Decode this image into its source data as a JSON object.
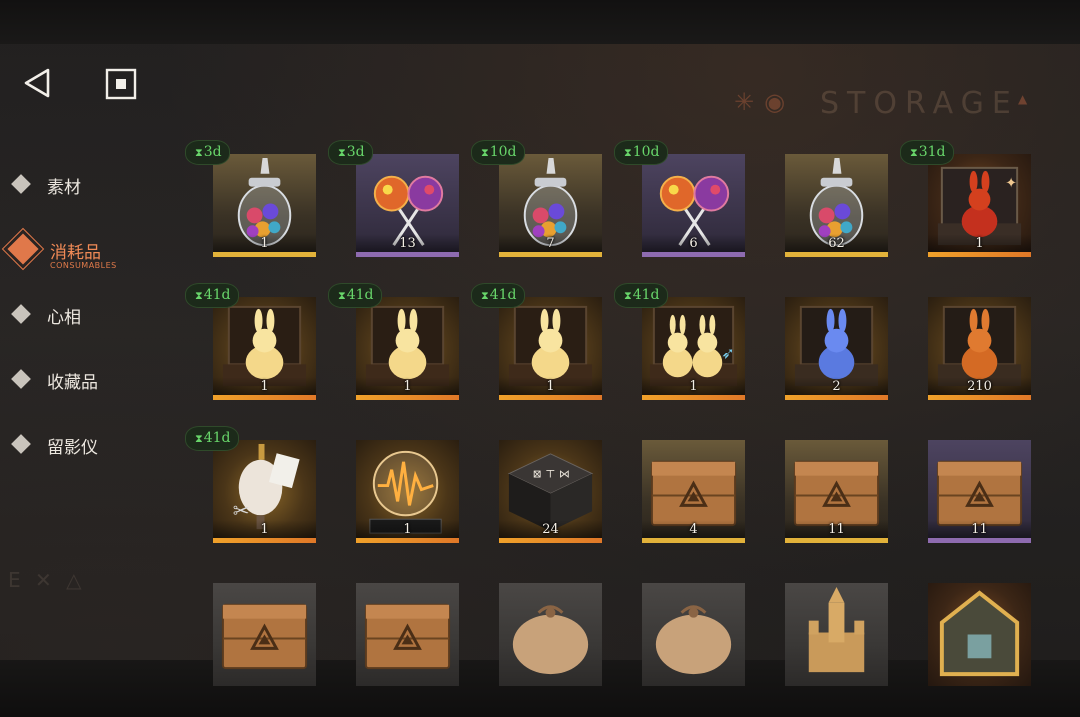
{
  "header": {
    "title": "STORAGE"
  },
  "colors": {
    "accent": "#e0784a",
    "timer": "#68d56a",
    "rarity_gold": "#e2b23a",
    "rarity_purple": "#8e6bb0"
  },
  "nav": {
    "back_icon": "back-triangle-icon",
    "home_icon": "square-home-icon",
    "items": [
      {
        "label": "素材",
        "sub": "",
        "active": false
      },
      {
        "label": "消耗品",
        "sub": "CONSUMABLES",
        "active": true
      },
      {
        "label": "心相",
        "sub": "",
        "active": false
      },
      {
        "label": "收藏品",
        "sub": "",
        "active": false
      },
      {
        "label": "留影仪",
        "sub": "",
        "active": false
      }
    ]
  },
  "items": [
    {
      "timer": "3d",
      "qty": "1",
      "rarity": "gold",
      "art": "candy-jar"
    },
    {
      "timer": "3d",
      "qty": "13",
      "rarity": "purple",
      "art": "lollipops"
    },
    {
      "timer": "10d",
      "qty": "7",
      "rarity": "gold",
      "art": "candy-jar"
    },
    {
      "timer": "10d",
      "qty": "6",
      "rarity": "purple",
      "art": "lollipops"
    },
    {
      "timer": "",
      "qty": "62",
      "rarity": "gold",
      "art": "candy-jar"
    },
    {
      "timer": "31d",
      "qty": "1",
      "rarity": "orange",
      "art": "rabbit-box-red"
    },
    {
      "timer": "41d",
      "qty": "1",
      "rarity": "yellow",
      "art": "rabbit-box-gold"
    },
    {
      "timer": "41d",
      "qty": "1",
      "rarity": "yellow",
      "art": "rabbit-box-gold"
    },
    {
      "timer": "41d",
      "qty": "1",
      "rarity": "yellow",
      "art": "rabbit-box-gold"
    },
    {
      "timer": "41d",
      "qty": "1",
      "rarity": "yellow",
      "art": "rabbit-box-gold-double"
    },
    {
      "timer": "",
      "qty": "2",
      "rarity": "yellow",
      "art": "rabbit-box-blue"
    },
    {
      "timer": "",
      "qty": "210",
      "rarity": "yellow",
      "art": "rabbit-box-amber"
    },
    {
      "timer": "41d",
      "qty": "1",
      "rarity": "yellow",
      "art": "tailor-bust"
    },
    {
      "timer": "",
      "qty": "1",
      "rarity": "yellow",
      "art": "radio-orb"
    },
    {
      "timer": "",
      "qty": "24",
      "rarity": "yellow",
      "art": "rune-table"
    },
    {
      "timer": "",
      "qty": "4",
      "rarity": "gold",
      "art": "wooden-crate"
    },
    {
      "timer": "",
      "qty": "11",
      "rarity": "gold",
      "art": "wooden-crate"
    },
    {
      "timer": "",
      "qty": "11",
      "rarity": "purple",
      "art": "wooden-crate"
    },
    {
      "timer": "",
      "qty": "",
      "rarity": "neutral",
      "art": "wooden-crate"
    },
    {
      "timer": "",
      "qty": "",
      "rarity": "neutral",
      "art": "wooden-crate"
    },
    {
      "timer": "",
      "qty": "",
      "rarity": "neutral",
      "art": "cloth-sack"
    },
    {
      "timer": "",
      "qty": "",
      "rarity": "neutral",
      "art": "cloth-sack"
    },
    {
      "timer": "",
      "qty": "",
      "rarity": "neutral",
      "art": "sand-castle"
    },
    {
      "timer": "",
      "qty": "",
      "rarity": "orange",
      "art": "house-frame"
    }
  ]
}
